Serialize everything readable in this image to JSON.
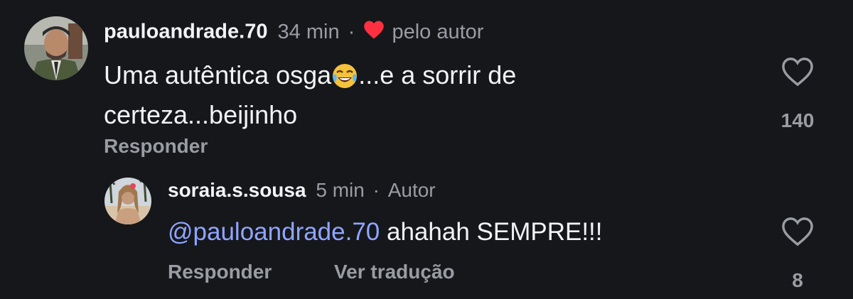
{
  "comments": [
    {
      "username": "pauloandrade.70",
      "time": "34 min",
      "separator": "·",
      "liked_by_author_label": "pelo autor",
      "text_before_emoji": "Uma autêntica osga",
      "emoji_icon": "face-with-tears-of-joy-icon",
      "text_after_emoji_line1": "...e a sorrir de",
      "text_line2": "certeza...beijinho",
      "reply_label": "Responder",
      "like_count": "140"
    },
    {
      "username": "soraia.s.sousa",
      "time": "5 min",
      "separator": "·",
      "author_badge": "Autor",
      "mention": "@pauloandrade.70",
      "text": " ahahah SEMPRE!!!",
      "reply_label": "Responder",
      "translate_label": "Ver tradução",
      "like_count": "8"
    }
  ],
  "colors": {
    "background": "#16171b",
    "text": "#f2f3f5",
    "muted": "#9a9ca3",
    "mention": "#8fa6ff",
    "heart_red": "#ff3040"
  }
}
